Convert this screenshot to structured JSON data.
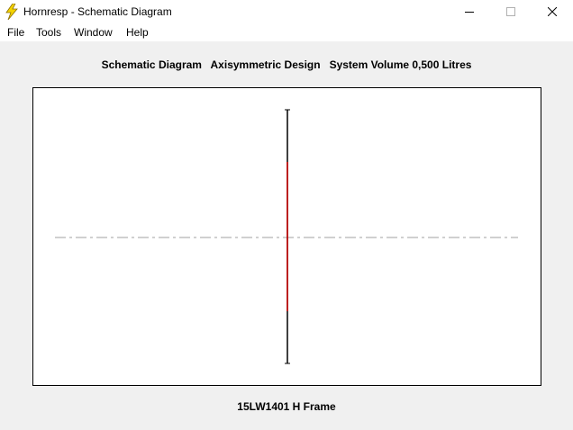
{
  "window": {
    "title": "Hornresp - Schematic Diagram",
    "icon": "lightning-bolt-icon"
  },
  "menu": {
    "items": [
      {
        "label": "File"
      },
      {
        "label": "Tools"
      },
      {
        "label": "Window"
      },
      {
        "label": "Help"
      }
    ]
  },
  "diagram": {
    "header": "Schematic Diagram   Axisymmetric Design   System Volume 0,500 Litres",
    "footer": "15LW1401 H Frame"
  },
  "colors": {
    "driver_line": "#d00000",
    "outline": "#000000",
    "axis": "#a0a0a0"
  }
}
